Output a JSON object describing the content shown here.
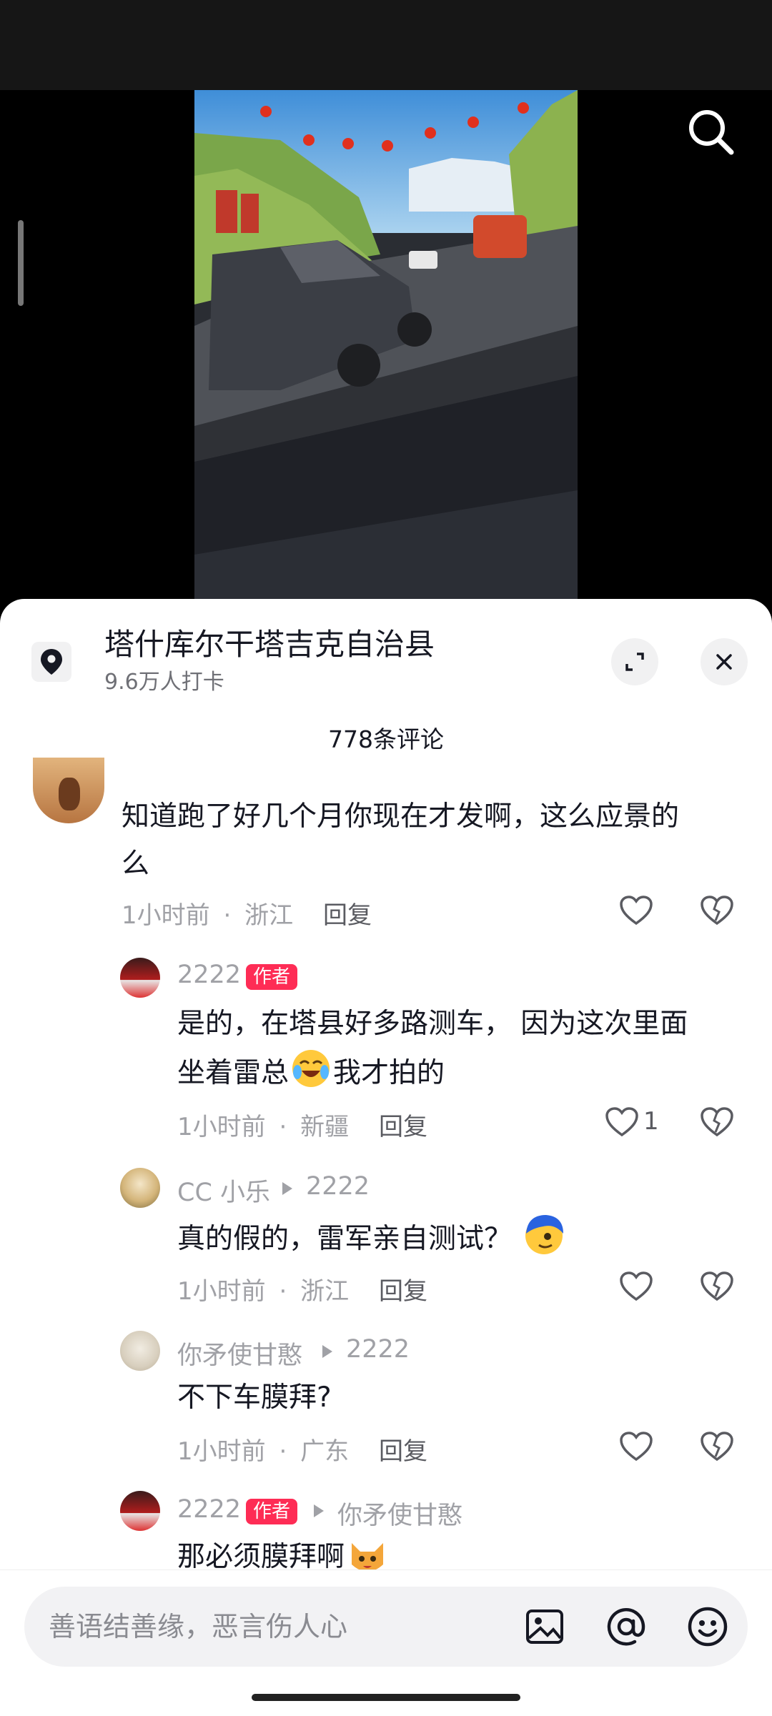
{
  "location": {
    "title": "塔什库尔干塔吉克自治县",
    "checkins": "9.6万人打卡"
  },
  "comments_header": "778条评论",
  "input": {
    "placeholder": "善语结善缘，恶言伤人心"
  },
  "comments": [
    {
      "text_line1": "知道跑了好几个月你现在才发啊，这么应景的",
      "text_line2": "么",
      "time": "1小时前",
      "region": "浙江",
      "reply_label": "回复"
    }
  ],
  "replies": [
    {
      "name": "2222",
      "badge": "作者",
      "text_line1": "是的，在塔县好多路测车， 因为这次里面",
      "text_line2a": "坐着雷总",
      "text_line2b": "我才拍的",
      "time": "1小时前",
      "region": "新疆",
      "reply_label": "回复",
      "likes": "1"
    },
    {
      "name": "CC 小乐",
      "reply_to": "2222",
      "text": "真的假的，雷军亲自测试？",
      "time": "1小时前",
      "region": "浙江",
      "reply_label": "回复"
    },
    {
      "name": "你矛使甘憨",
      "reply_to": "2222",
      "text": "不下车膜拜?",
      "time": "1小时前",
      "region": "广东",
      "reply_label": "回复"
    },
    {
      "name": "2222",
      "badge": "作者",
      "reply_to": "你矛使甘憨",
      "text": "那必须膜拜啊"
    }
  ],
  "meta_separator": "·",
  "colors": {
    "accent": "#fe2c55",
    "sheet_bg": "#ffffff",
    "meta_text": "#a0a1a6"
  }
}
